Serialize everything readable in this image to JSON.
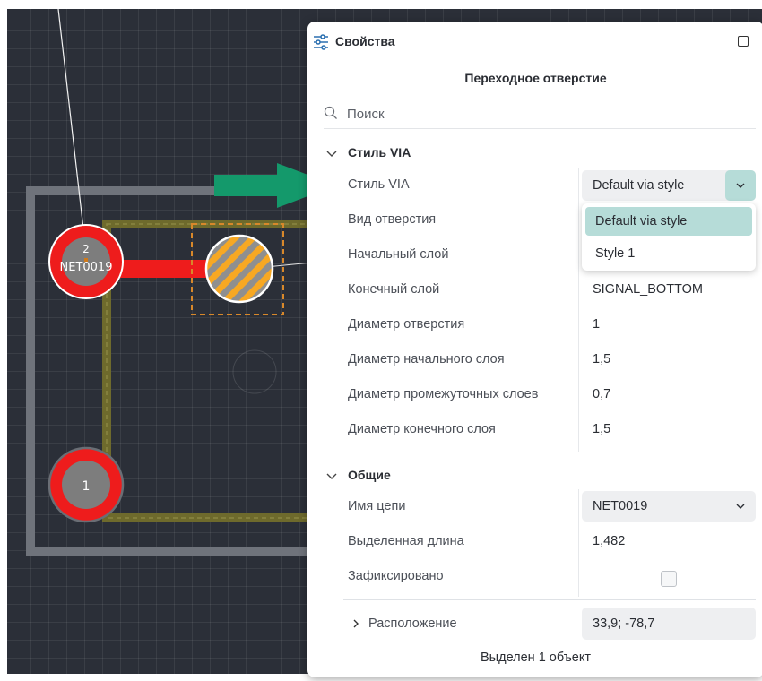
{
  "panel": {
    "title": "Свойства",
    "object_title": "Переходное отверстие",
    "search": {
      "placeholder": "Поиск"
    },
    "status": "Выделен 1 объект"
  },
  "via_section": {
    "title": "Стиль VIA",
    "rows": [
      {
        "key": "Стиль VIA",
        "value": "Default via style"
      },
      {
        "key": "Вид отверстия",
        "value": ""
      },
      {
        "key": "Начальный слой",
        "value": ""
      },
      {
        "key": "Конечный слой",
        "value": "SIGNAL_BOTTOM"
      },
      {
        "key": "Диаметр отверстия",
        "value": "1"
      },
      {
        "key": "Диаметр начального слоя",
        "value": "1,5"
      },
      {
        "key": "Диаметр промежуточных слоев",
        "value": "0,7"
      },
      {
        "key": "Диаметр конечного слоя",
        "value": "1,5"
      }
    ],
    "dropdown_options": [
      "Default via style",
      "Style 1"
    ],
    "selected_option": "Default via style"
  },
  "general_section": {
    "title": "Общие",
    "rows": [
      {
        "key": "Имя цепи",
        "value": "NET0019"
      },
      {
        "key": "Выделенная длина",
        "value": "1,482"
      },
      {
        "key": "Зафиксировано",
        "value": false
      },
      {
        "key": "Расположение",
        "value": "33,9; -78,7"
      }
    ]
  },
  "canvas": {
    "pad_top_number": "2",
    "pad_top_net": "NET0019",
    "pad_bottom_number": "1"
  },
  "colors": {
    "accent": "#b6dcd8",
    "arrow": "#14996b",
    "pad": "#ee1c1c",
    "board_outline": "#6f737b",
    "keepout": "#6e6a2c",
    "canvas_bg": "#2b2f38",
    "via_stripe": "#f7a823"
  },
  "icons": [
    "filter-settings-icon",
    "maximize-icon",
    "search-icon",
    "chevron-down-icon",
    "chevron-right-icon",
    "green-arrow-icon"
  ]
}
